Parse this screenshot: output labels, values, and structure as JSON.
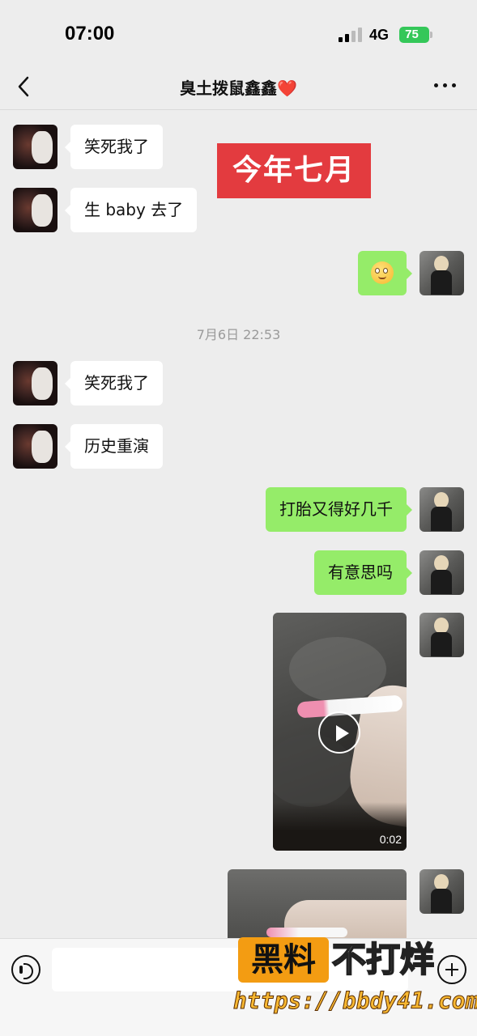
{
  "status_bar": {
    "time": "07:00",
    "network": "4G",
    "battery": "75"
  },
  "header": {
    "back_icon": "chevron-left-icon",
    "title": "臭土拨鼠鑫鑫",
    "title_emoji": "❤️",
    "more_icon": "more-dots-icon"
  },
  "overlay_label": "今年七月",
  "messages": [
    {
      "side": "left",
      "type": "text",
      "text": "笑死我了"
    },
    {
      "side": "left",
      "type": "text",
      "text": "生 baby 去了"
    },
    {
      "side": "right",
      "type": "emoji",
      "emoji": "flushed-face-emoji"
    },
    {
      "side": "left",
      "type": "text",
      "text": "笑死我了"
    },
    {
      "side": "left",
      "type": "text",
      "text": "历史重演"
    },
    {
      "side": "right",
      "type": "text",
      "text": "打胎又得好几千"
    },
    {
      "side": "right",
      "type": "text",
      "text": "有意思吗"
    },
    {
      "side": "right",
      "type": "video",
      "duration": "0:02"
    },
    {
      "side": "right",
      "type": "image"
    }
  ],
  "timestamp": "7月6日 22:53",
  "input_bar": {
    "voice_icon": "voice-icon",
    "placeholder": "",
    "plus_icon": "plus-circle-icon"
  },
  "watermark": {
    "box_text": "黑料",
    "text": "不打烊",
    "url": "https://bbdy41.com"
  },
  "colors": {
    "background": "#ededed",
    "sent_bubble": "#95ec69",
    "received_bubble": "#ffffff",
    "overlay": "#e33b3f",
    "battery": "#34c759"
  }
}
